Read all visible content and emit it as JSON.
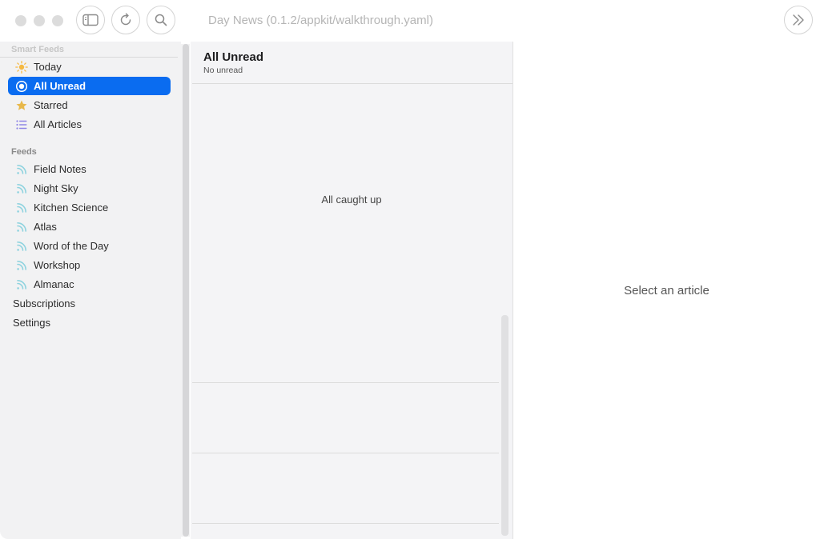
{
  "window": {
    "title": "Day News (0.1.2/appkit/walkthrough.yaml)"
  },
  "toolbar": {
    "sidebar_icon": "sidebar-toggle-icon",
    "refresh_icon": "refresh-icon",
    "search_icon": "search-icon",
    "forward_icon": "chevron-double-right-icon"
  },
  "sidebar": {
    "smart_feeds_label": "Smart Feeds",
    "smart_feeds": [
      {
        "label": "Today",
        "icon": "sun-icon"
      },
      {
        "label": "All Unread",
        "icon": "unread-circle-icon",
        "selected": true
      },
      {
        "label": "Starred",
        "icon": "star-icon"
      },
      {
        "label": "All Articles",
        "icon": "list-icon"
      }
    ],
    "feeds_label": "Feeds",
    "feeds": [
      {
        "label": "Field Notes",
        "icon": "rss-icon"
      },
      {
        "label": "Night Sky",
        "icon": "rss-icon"
      },
      {
        "label": "Kitchen Science",
        "icon": "rss-icon"
      },
      {
        "label": "Atlas",
        "icon": "rss-icon"
      },
      {
        "label": "Word of the Day",
        "icon": "rss-icon"
      },
      {
        "label": "Workshop",
        "icon": "rss-icon"
      },
      {
        "label": "Almanac",
        "icon": "rss-icon"
      }
    ],
    "subscriptions_label": "Subscriptions",
    "settings_label": "Settings"
  },
  "article_list": {
    "title": "All Unread",
    "subtitle": "No unread",
    "empty_message": "All caught up"
  },
  "detail": {
    "placeholder": "Select an article"
  },
  "colors": {
    "accent": "#0a6cf0",
    "sun": "#f5b942",
    "star": "#e8b84a",
    "list": "#8f86e6",
    "rss": "#8fd3df"
  }
}
